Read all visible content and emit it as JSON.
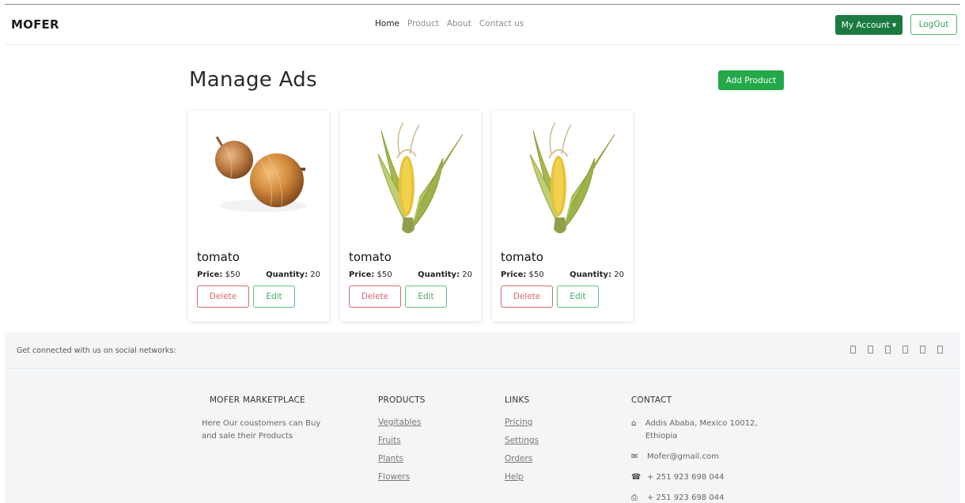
{
  "nav": {
    "brand": "MOFER",
    "links": [
      "Home",
      "Product",
      "About",
      "Contact us"
    ],
    "account_label": "My Account",
    "logout_label": "LogOut"
  },
  "main": {
    "title": "Manage Ads",
    "add_label": "Add Product",
    "products": [
      {
        "name": "tomato",
        "price_label": "Price:",
        "price": "$50",
        "qty_label": "Quantity:",
        "qty": "20",
        "image": "onions",
        "delete": "Delete",
        "edit": "Edit"
      },
      {
        "name": "tomato",
        "price_label": "Price:",
        "price": "$50",
        "qty_label": "Quantity:",
        "qty": "20",
        "image": "corn",
        "delete": "Delete",
        "edit": "Edit"
      },
      {
        "name": "tomato",
        "price_label": "Price:",
        "price": "$50",
        "qty_label": "Quantity:",
        "qty": "20",
        "image": "corn",
        "delete": "Delete",
        "edit": "Edit"
      }
    ]
  },
  "social": {
    "text": "Get connected with us on social networks:",
    "icons": [
      "facebook-icon",
      "twitter-icon",
      "google-icon",
      "instagram-icon",
      "linkedin-icon",
      "github-icon"
    ]
  },
  "footer": {
    "about": {
      "heading": "MOFER MARKETPLACE",
      "text": "Here Our coustomers can Buy and sale their Products"
    },
    "products": {
      "heading": "PRODUCTS",
      "links": [
        "Vegitables",
        "Fruits",
        "Plants",
        "Flowers"
      ]
    },
    "links": {
      "heading": "LINKS",
      "links": [
        "Pricing",
        "Settings",
        "Orders",
        "Help"
      ]
    },
    "contact": {
      "heading": "CONTACT",
      "address": "Addis Ababa, Mexico 10012, Ethiopia",
      "email": "Mofer@gmail.com",
      "phone": "+ 251 923 698 044",
      "fax": "+ 251 923 698 044"
    }
  },
  "colors": {
    "primary_green": "#1a7a40",
    "add_green": "#23a84a",
    "delete_red": "#d6676f"
  }
}
